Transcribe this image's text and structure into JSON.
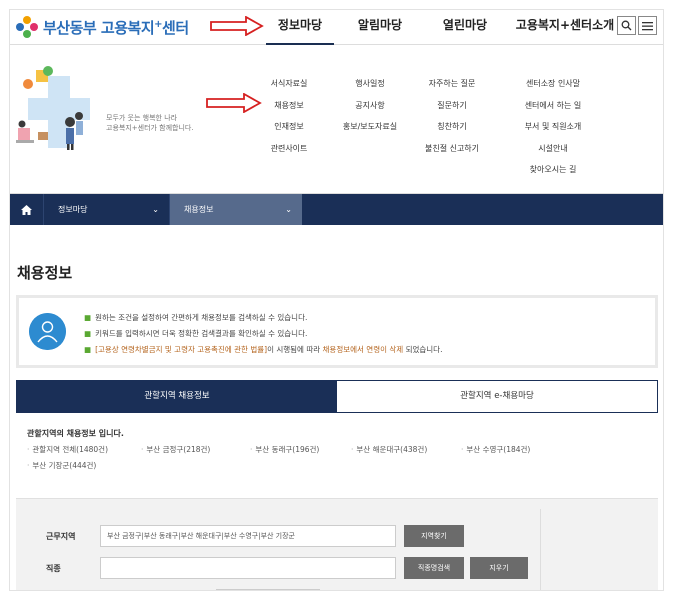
{
  "header": {
    "logo_text": "부산동부 고용복지",
    "logo_plus": "+",
    "logo_suffix": "센터",
    "gnb": [
      {
        "label": "정보마당",
        "active": true
      },
      {
        "label": "알림마당",
        "active": false
      },
      {
        "label": "열린마당",
        "active": false
      },
      {
        "label": "고용복지+센터소개",
        "active": false
      }
    ],
    "search_icon": "search-icon",
    "menu_icon": "hamburger-menu-icon"
  },
  "mega_menu": {
    "slogan_line1": "모두가 웃는 행복한 나라",
    "slogan_line2": "고용복지+센터가 함께합니다.",
    "columns": [
      [
        "서식자료실",
        "채용정보",
        "인재정보",
        "관련사이트"
      ],
      [
        "행사일정",
        "공지사항",
        "홍보/보도자료실"
      ],
      [
        "자주하는 질문",
        "질문하기",
        "칭찬하기",
        "불친절 신고하기"
      ],
      [
        "센터소장 인사말",
        "센터에서 하는 일",
        "부서 및 직원소개",
        "시설안내",
        "찾아오시는 길"
      ]
    ]
  },
  "breadcrumb": {
    "home_icon": "home-icon",
    "level1": "정보마당",
    "level2": "채용정보"
  },
  "page_title": "채용정보",
  "info": {
    "line1": "원하는 조건을 설정하여 간편하게 채용정보를 검색하실 수 있습니다.",
    "line2": "키워드를 입력하시면 더욱 정확한 검색결과를 확인하실 수 있습니다.",
    "line3_hl1": "[고용상 연령차별금지 및 고령자 고용촉진에 관한 법률]",
    "line3_mid": "이 시행됨에 따라 ",
    "line3_hl2": "채용정보에서 연령이 삭제",
    "line3_end": " 되었습니다."
  },
  "tabs": [
    {
      "label": "관할지역 채용정보",
      "active": true
    },
    {
      "label": "관할지역 e-채용마당",
      "active": false
    }
  ],
  "regions": {
    "heading": "관할지역의 채용정보 입니다.",
    "items": [
      "관할지역 전체(1480건)",
      "부산 금정구(218건)",
      "부산 동래구(196건)",
      "부산 해운대구(438건)",
      "부산 수영구(184건)",
      "부산 기장군(444건)"
    ]
  },
  "search": {
    "region_label": "근무지역",
    "region_value": "부산 금정구|부산 동래구|부산 해운대구|부산 수영구|부산 기장군",
    "region_button": "지역찾기",
    "job_label": "직종",
    "job_value": "",
    "job_button": "직종명검색",
    "clear_button": "지우기"
  },
  "colors": {
    "navy": "#1a2f57",
    "accent_green": "#5aa832",
    "highlight_orange": "#b4641e",
    "arrow_red": "#d62020"
  }
}
